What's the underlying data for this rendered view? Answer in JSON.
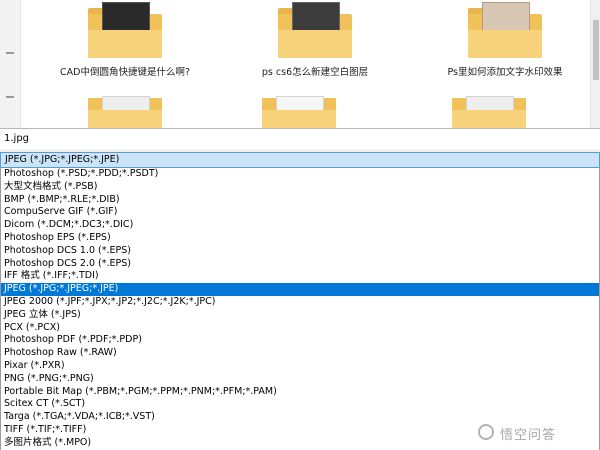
{
  "browser": {
    "files": [
      {
        "label": "CAD中倒圆角快捷键是什么啊?"
      },
      {
        "label": "ps cs6怎么新建空白图层"
      },
      {
        "label": "Ps里如何添加文字水印效果"
      }
    ]
  },
  "save_dialog": {
    "filename": "1.jpg",
    "format_selected": "JPEG (*.JPG;*.JPEG;*.JPE)",
    "formats": [
      {
        "label": "Photoshop (*.PSD;*.PDD;*.PSDT)",
        "selected": false
      },
      {
        "label": "大型文档格式 (*.PSB)",
        "selected": false
      },
      {
        "label": "BMP (*.BMP;*.RLE;*.DIB)",
        "selected": false
      },
      {
        "label": "CompuServe GIF (*.GIF)",
        "selected": false
      },
      {
        "label": "Dicom (*.DCM;*.DC3;*.DIC)",
        "selected": false
      },
      {
        "label": "Photoshop EPS (*.EPS)",
        "selected": false
      },
      {
        "label": "Photoshop DCS 1.0 (*.EPS)",
        "selected": false
      },
      {
        "label": "Photoshop DCS 2.0 (*.EPS)",
        "selected": false
      },
      {
        "label": "IFF 格式 (*.IFF;*.TDI)",
        "selected": false
      },
      {
        "label": "JPEG (*.JPG;*.JPEG;*.JPE)",
        "selected": true
      },
      {
        "label": "JPEG 2000 (*.JPF;*.JPX;*.JP2;*.J2C;*.J2K;*.JPC)",
        "selected": false
      },
      {
        "label": "JPEG 立体 (*.JPS)",
        "selected": false
      },
      {
        "label": "PCX (*.PCX)",
        "selected": false
      },
      {
        "label": "Photoshop PDF (*.PDF;*.PDP)",
        "selected": false
      },
      {
        "label": "Photoshop Raw (*.RAW)",
        "selected": false
      },
      {
        "label": "Pixar (*.PXR)",
        "selected": false
      },
      {
        "label": "PNG (*.PNG;*.PNG)",
        "selected": false
      },
      {
        "label": "Portable Bit Map (*.PBM;*.PGM;*.PPM;*.PNM;*.PFM;*.PAM)",
        "selected": false
      },
      {
        "label": "Scitex CT (*.SCT)",
        "selected": false
      },
      {
        "label": "Targa (*.TGA;*.VDA;*.ICB;*.VST)",
        "selected": false
      },
      {
        "label": "TIFF (*.TIF;*.TIFF)",
        "selected": false
      },
      {
        "label": "多图片格式 (*.MPO)",
        "selected": false
      }
    ]
  },
  "watermark": {
    "text": "悟空问答"
  },
  "colors": {
    "selection": "#0078d7",
    "combo_background": "#cce4f7",
    "folder": "#f1c15a"
  }
}
